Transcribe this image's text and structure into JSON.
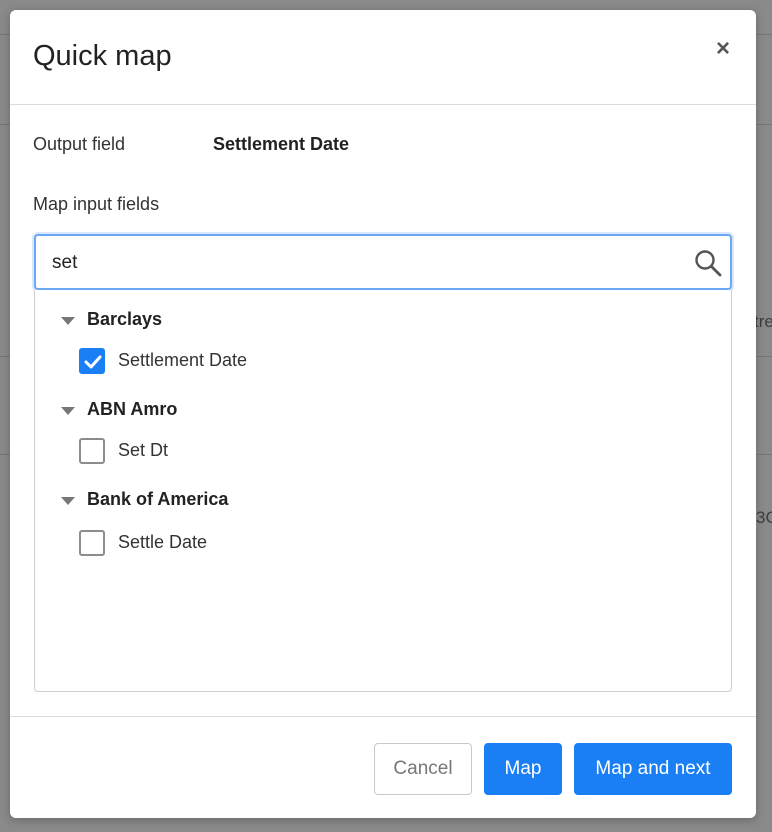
{
  "background": {
    "fragment_1": "tre",
    "fragment_2": "3C"
  },
  "modal": {
    "title": "Quick map",
    "close_icon": "×",
    "output_field_label": "Output field",
    "output_field_value": "Settlement Date",
    "map_input_label": "Map input fields",
    "search": {
      "value": "set",
      "icon": "search-icon"
    },
    "groups": [
      {
        "name": "Barclays",
        "items": [
          {
            "label": "Settlement Date",
            "checked": true
          }
        ]
      },
      {
        "name": "ABN Amro",
        "items": [
          {
            "label": "Set Dt",
            "checked": false
          }
        ]
      },
      {
        "name": "Bank of America",
        "items": [
          {
            "label": "Settle Date",
            "checked": false
          }
        ]
      }
    ],
    "buttons": {
      "cancel": "Cancel",
      "map": "Map",
      "map_next": "Map and next"
    }
  },
  "colors": {
    "primary": "#1a7ff5",
    "focus_border": "#6aa7f5",
    "overlay": "#8a8a8a"
  }
}
